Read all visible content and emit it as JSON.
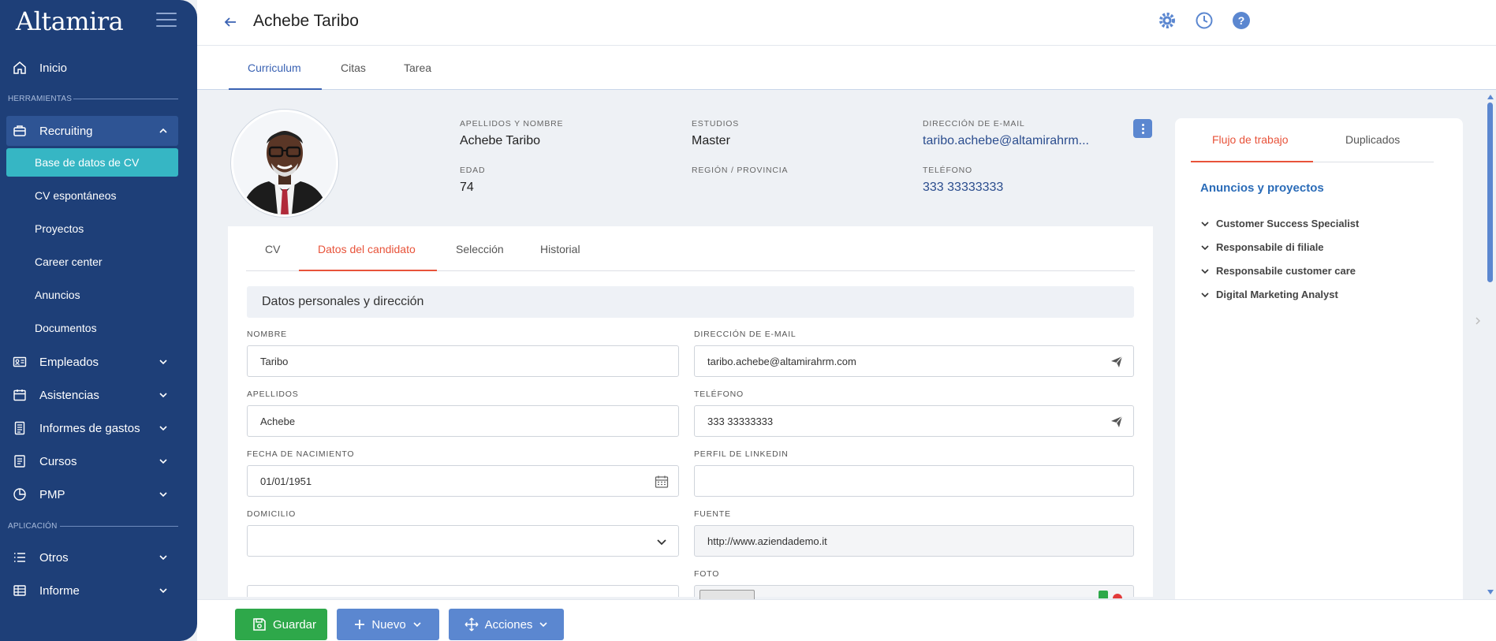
{
  "app": {
    "logo": "Altamira"
  },
  "sidebar": {
    "home": "Inicio",
    "section_tools": "HERRAMIENTAS",
    "recruiting": "Recruiting",
    "sub_items": [
      "Base de datos de CV",
      "CV espontáneos",
      "Proyectos",
      "Career center",
      "Anuncios",
      "Documentos"
    ],
    "groups": [
      "Empleados",
      "Asistencias",
      "Informes de gastos",
      "Cursos",
      "PMP"
    ],
    "section_app": "APLICACIÓN",
    "app_items": [
      "Otros",
      "Informe"
    ]
  },
  "header": {
    "title": "Achebe Taribo"
  },
  "top_tabs": [
    "Curriculum",
    "Citas",
    "Tarea"
  ],
  "profile": {
    "name_label": "APELLIDOS Y NOMBRE",
    "name": "Achebe Taribo",
    "studies_label": "ESTUDIOS",
    "studies": "Master",
    "email_label": "DIRECCIÓN DE E-MAIL",
    "email": "taribo.achebe@altamirahrm...",
    "age_label": "EDAD",
    "age": "74",
    "region_label": "REGIÓN / PROVINCIA",
    "region": "",
    "phone_label": "TELÉFONO",
    "phone": "333 33333333"
  },
  "sub_tabs": [
    "CV",
    "Datos del candidato",
    "Selección",
    "Historial"
  ],
  "form": {
    "section_title": "Datos personales y dirección",
    "nombre_label": "NOMBRE",
    "nombre": "Taribo",
    "email_label": "DIRECCIÓN DE E-MAIL",
    "email": "taribo.achebe@altamirahrm.com",
    "apellidos_label": "APELLIDOS",
    "apellidos": "Achebe",
    "telefono_label": "TELÉFONO",
    "telefono": "333 33333333",
    "fecha_label": "FECHA DE NACIMIENTO",
    "fecha": "01/01/1951",
    "linkedin_label": "PERFIL DE LINKEDIN",
    "linkedin": "",
    "domicilio_label": "DOMICILIO",
    "domicilio": "",
    "fuente_label": "FUENTE",
    "fuente": "http://www.aziendademo.it",
    "foto_label": "FOTO"
  },
  "right_panel": {
    "tabs": [
      "Flujo de trabajo",
      "Duplicados"
    ],
    "heading": "Anuncios y proyectos",
    "items": [
      "Customer Success Specialist",
      "Responsabile di filiale",
      "Responsabile customer care",
      "Digital Marketing Analyst"
    ]
  },
  "footer": {
    "save": "Guardar",
    "new": "Nuevo",
    "actions": "Acciones"
  },
  "colors": {
    "sidebar": "#1e3f78",
    "active_sub": "#36b6c4",
    "accent": "#e8533a",
    "link": "#2b6cb8",
    "save": "#2ea84a",
    "button": "#5b87d0"
  }
}
